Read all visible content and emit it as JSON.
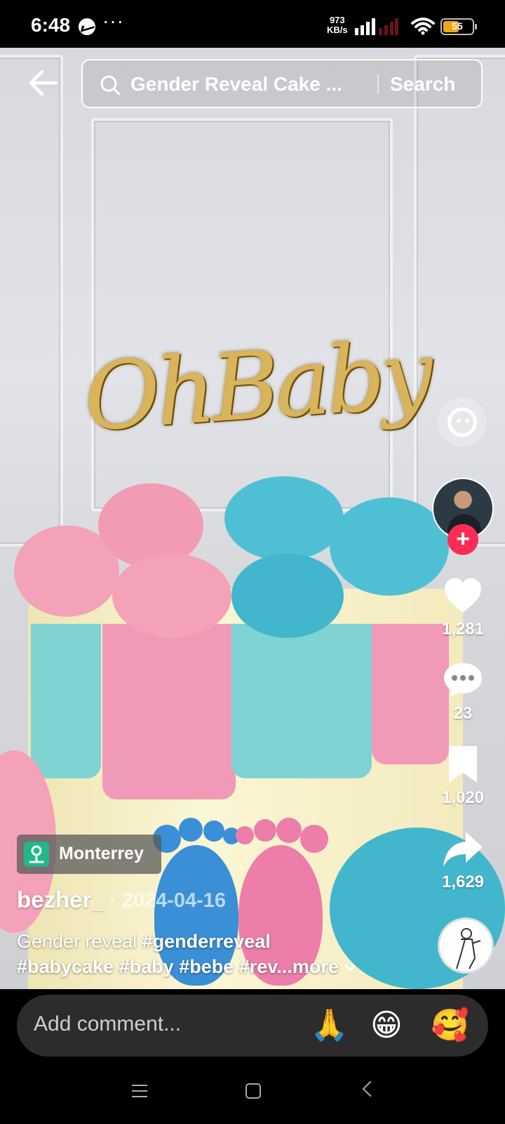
{
  "status_bar": {
    "time": "6:48",
    "more_dots": "···",
    "speed_value": "973",
    "speed_unit": "KB/s",
    "battery_level": "55",
    "battery_color": "#f2a51a"
  },
  "search": {
    "query": "Gender Reveal Cake ...",
    "button_label": "Search"
  },
  "video": {
    "topper_text": "OhBaby"
  },
  "rail": {
    "likes": "1,281",
    "comments": "23",
    "saves": "1,020",
    "shares": "1,629",
    "follow_symbol": "+",
    "follow_color": "#fe2c55"
  },
  "post": {
    "location": "Monterrey",
    "username": "bezher_",
    "date": "· 2024-04-16",
    "caption_text": "Gender reveal ",
    "hashtags": [
      "#genderreveal",
      "#babycake",
      "#baby",
      "#bebe",
      "#rev..."
    ],
    "more_label": "more"
  },
  "comment_bar": {
    "placeholder": "Add comment...",
    "emojis": [
      "🙏",
      "😁",
      "🥰"
    ]
  },
  "icons": {
    "back": "back-arrow-icon",
    "search": "search-icon",
    "like": "heart-icon",
    "comment": "comment-bubble-icon",
    "save": "bookmark-icon",
    "share": "share-arrow-icon",
    "location": "location-pin-icon"
  }
}
